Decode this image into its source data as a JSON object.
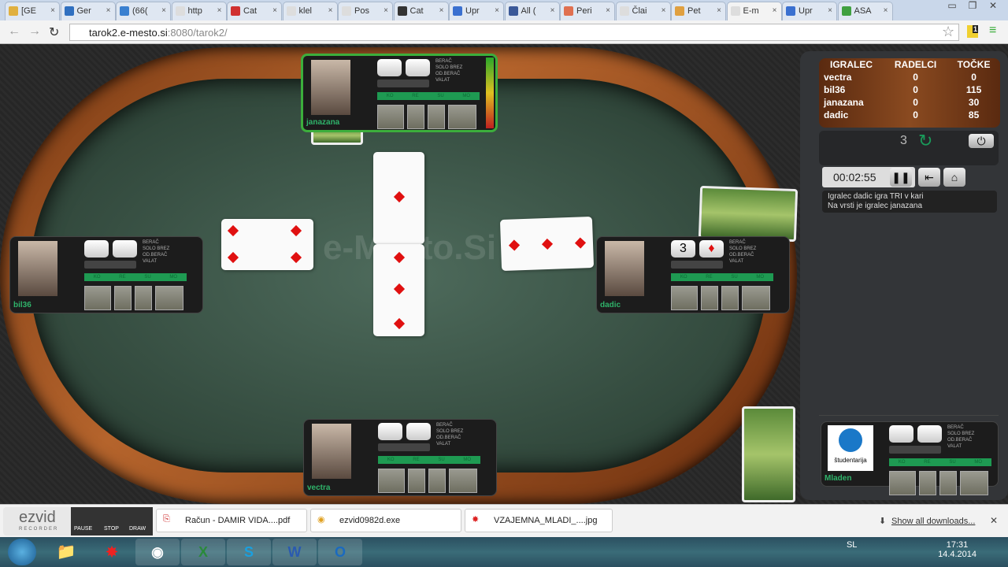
{
  "browser": {
    "tabs": [
      {
        "label": "[GE",
        "color": "#e0b040"
      },
      {
        "label": "Ger",
        "color": "#3070c0"
      },
      {
        "label": "(66(",
        "color": "#3a80d0"
      },
      {
        "label": "http",
        "color": "#ddd"
      },
      {
        "label": "Cat",
        "color": "#d03030"
      },
      {
        "label": "klel",
        "color": "#ddd"
      },
      {
        "label": "Pos",
        "color": "#ddd"
      },
      {
        "label": "Cat",
        "color": "#333"
      },
      {
        "label": "Upr",
        "color": "#3a70d0"
      },
      {
        "label": "All (",
        "color": "#3b5998"
      },
      {
        "label": "Peri",
        "color": "#e07050"
      },
      {
        "label": "Člai",
        "color": "#ddd"
      },
      {
        "label": "Pet",
        "color": "#e0a040"
      },
      {
        "label": "E-m",
        "color": "#ddd",
        "active": true
      },
      {
        "label": "Upr",
        "color": "#3a70d0"
      },
      {
        "label": "ASA",
        "color": "#40a040"
      }
    ],
    "url_host": "tarok2.e-mesto.si",
    "url_rest": ":8080/tarok2/",
    "extension_badge": "1"
  },
  "game": {
    "logo": "e-Mesto.Si",
    "panel_labels": [
      "BERAČ",
      "SOLO BREZ",
      "OD.BERAČ",
      "VALAT"
    ],
    "announce": [
      "KO",
      "RE",
      "SU",
      "MO"
    ],
    "players": [
      {
        "name": "janazana",
        "active": true,
        "b1": "",
        "b2": ""
      },
      {
        "name": "bil36",
        "b1": "",
        "b2": ""
      },
      {
        "name": "dadic",
        "b1": "3",
        "b2": "♦"
      },
      {
        "name": "vectra",
        "b1": "",
        "b2": ""
      },
      {
        "name": "Mladen",
        "b1": "",
        "b2": "",
        "sponsor": "študentarija"
      }
    ]
  },
  "sidebar": {
    "score_headers": [
      "IGRALEC",
      "RADELCI",
      "TOČKE"
    ],
    "scores": [
      [
        "vectra",
        "0",
        "0"
      ],
      [
        "bil36",
        "0",
        "115"
      ],
      [
        "janazana",
        "0",
        "30"
      ],
      [
        "dadic",
        "0",
        "85"
      ]
    ],
    "round": "3",
    "timer": "00:02:55",
    "messages": [
      "Igralec dadic igra TRI v kari",
      "Na vrsti je igralec janazana"
    ]
  },
  "downloads": {
    "items": [
      "Račun - DAMIR VIDA....pdf",
      "ezvid0982d.exe",
      "VZAJEMNA_MLADI_....jpg"
    ],
    "show_all": "Show all downloads...",
    "recorder": {
      "brand": "ezvid",
      "sub": "RECORDER",
      "pause": "PAUSE",
      "stop": "STOP",
      "draw": "DRAW"
    }
  },
  "taskbar": {
    "lang": "SL",
    "time": "17:31",
    "date": "14.4.2014"
  }
}
